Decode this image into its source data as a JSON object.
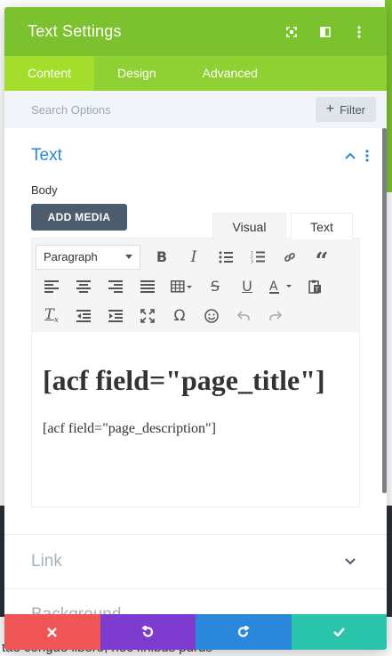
{
  "modal": {
    "title": "Text Settings",
    "header_icons": [
      "expand-icon",
      "split-view-icon",
      "more-vertical-icon"
    ]
  },
  "tabs": [
    {
      "label": "Content",
      "active": true
    },
    {
      "label": "Design",
      "active": false
    },
    {
      "label": "Advanced",
      "active": false
    }
  ],
  "search": {
    "placeholder": "Search Options",
    "filter_label": "Filter"
  },
  "text_section": {
    "title": "Text",
    "body_label": "Body",
    "add_media_label": "ADD MEDIA",
    "editor_tabs": {
      "visual": "Visual",
      "text": "Text"
    },
    "format_select": "Paragraph",
    "heading_content": "[acf field=\"page_title\"]",
    "paragraph_content": "[acf field=\"page_description\"]"
  },
  "collapsed_sections": {
    "link": "Link",
    "background": "Background"
  },
  "background_page": {
    "bottom_text": "tae congue libero, nec finibus purus"
  },
  "colors": {
    "header": "#7cc12e",
    "tabs": "#8fd032",
    "active_tab": "#a4dd2c",
    "accent_blue": "#2b87da",
    "cancel": "#ef5555",
    "undo": "#7e3bd0",
    "redo": "#2b87da",
    "save": "#29c4a9"
  }
}
